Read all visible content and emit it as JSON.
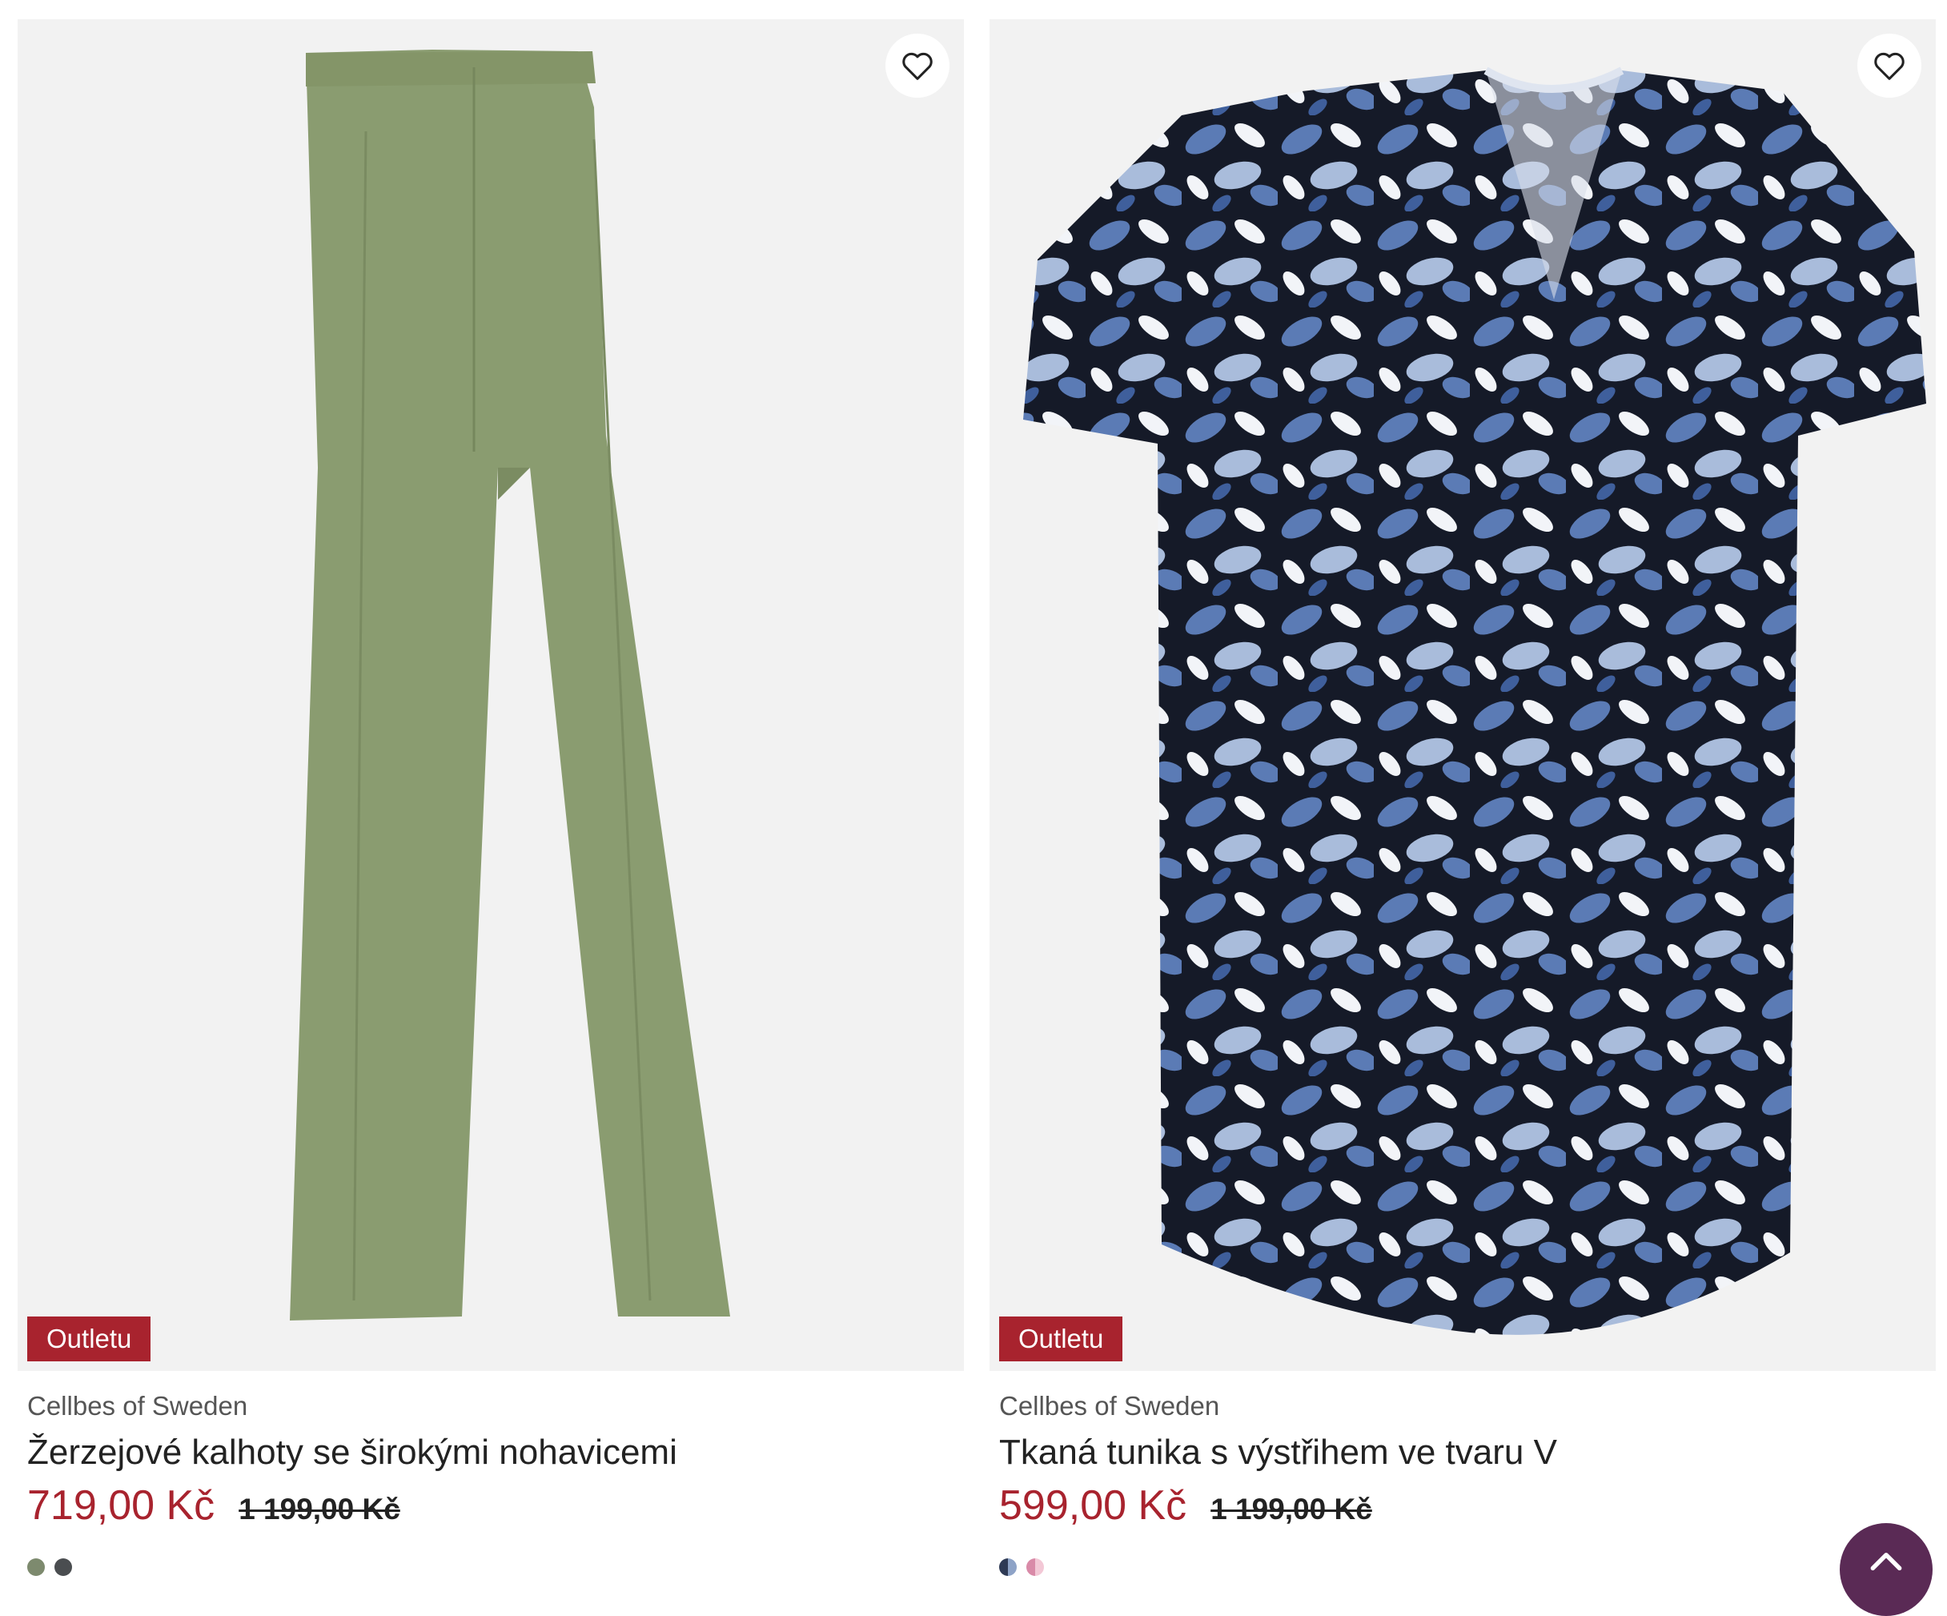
{
  "products": [
    {
      "badge": "Outletu",
      "brand": "Cellbes of Sweden",
      "title": "Žerzejové kalhoty se širokými nohavicemi",
      "price_sale": "719,00 Kč",
      "price_old": "1 199,00 Kč",
      "image_icon": "wide-leg-trousers",
      "swatches": [
        "#7d8a6e",
        "#4a4d50"
      ]
    },
    {
      "badge": "Outletu",
      "brand": "Cellbes of Sweden",
      "title": "Tkaná tunika s výstřihem ve tvaru V",
      "price_sale": "599,00 Kč",
      "price_old": "1 199,00 Kč",
      "image_icon": "floral-tunic",
      "swatches": [
        "#2e3a55",
        "#d98aa8"
      ]
    }
  ],
  "colors": {
    "sale_red": "#a8232e",
    "image_bg": "#f2f2f2",
    "scroll_top_bg": "#5a2a55",
    "trousers_green": "#8a9c70",
    "tunic_blue": "#5b7bb5",
    "tunic_dark": "#151a28"
  },
  "icons": {
    "favorite": "heart-outline-icon",
    "scroll_top": "chevron-up-icon"
  }
}
